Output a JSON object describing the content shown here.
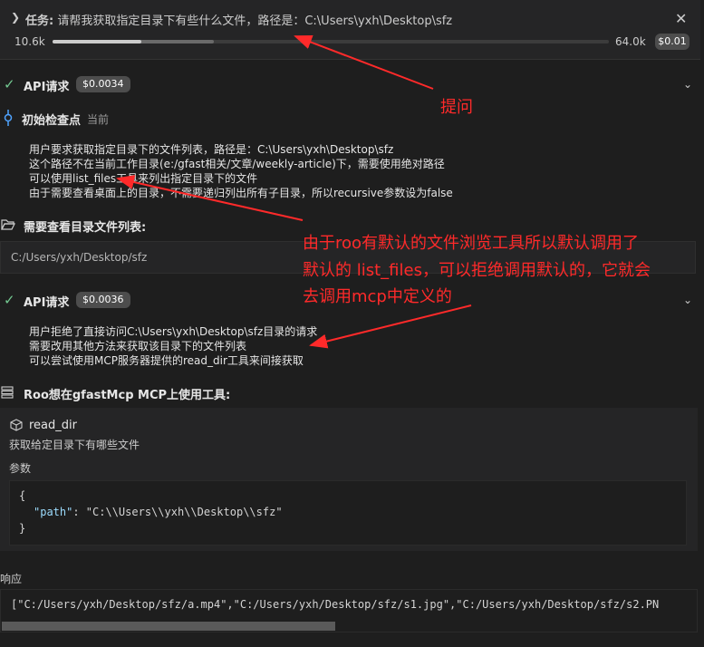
{
  "task": {
    "label": "任务:",
    "text": " 请帮我获取指定目录下有些什么文件，路径是：C:\\Users\\yxh\\Desktop\\sfz",
    "tokens_start": "10.6k",
    "tokens_end": "64.0k",
    "cost": "$0.01",
    "context_used_fraction": 0.16,
    "context_reserved_fraction": 0.29
  },
  "api_request_1": {
    "title": "API请求",
    "cost": "$0.0034"
  },
  "checkpoint": {
    "title": "初始检查点",
    "tag": "当前"
  },
  "reasoning_1": [
    "用户要求获取指定目录下的文件列表，路径是：C:\\Users\\yxh\\Desktop\\sfz",
    "这个路径不在当前工作目录(e:/gfast相关/文章/weekly-article)下，需要使用绝对路径",
    "可以使用list_files工具来列出指定目录下的文件",
    "由于需要查看桌面上的目录，不需要递归列出所有子目录，所以recursive参数设为false"
  ],
  "list_dir": {
    "title": "需要查看目录文件列表:",
    "path": "C:/Users/yxh/Desktop/sfz"
  },
  "api_request_2": {
    "title": "API请求",
    "cost": "$0.0036"
  },
  "reasoning_2": [
    "用户拒绝了直接访问C:\\Users\\yxh\\Desktop\\sfz目录的请求",
    "需要改用其他方法来获取该目录下的文件列表",
    "可以尝试使用MCP服务器提供的read_dir工具来间接获取"
  ],
  "mcp": {
    "title": "Roo想在gfastMcp MCP上使用工具:",
    "tool_name": "read_dir",
    "tool_desc": "获取给定目录下有哪些文件",
    "params_label": "参数",
    "code_open": "{",
    "code_key": "\"path\"",
    "code_value": ": \"C:\\\\Users\\\\yxh\\\\Desktop\\\\sfz\"",
    "code_close": "}"
  },
  "response": {
    "label": "响应",
    "text": "[\"C:/Users/yxh/Desktop/sfz/a.mp4\",\"C:/Users/yxh/Desktop/sfz/s1.jpg\",\"C:/Users/yxh/Desktop/sfz/s2.PN"
  },
  "annotations": {
    "a1": "提问",
    "a2_line1": "由于roo有默认的文件浏览工具所以默认调用了",
    "a2_line2": "默认的 list_files，可以拒绝调用默认的，它就会",
    "a2_line3": "去调用mcp中定义的"
  },
  "colors": {
    "annotation": "#ff2a2a",
    "check": "#73c991",
    "json_key": "#9cdcfe"
  }
}
